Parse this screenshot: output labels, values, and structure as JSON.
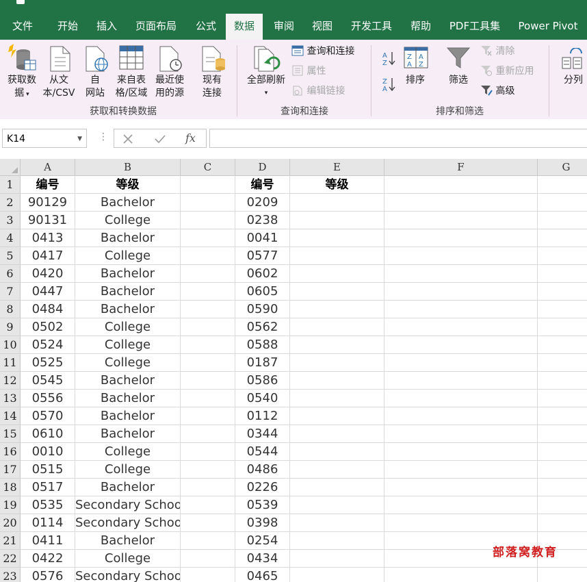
{
  "tabs": [
    "文件",
    "开始",
    "插入",
    "页面布局",
    "公式",
    "数据",
    "审阅",
    "视图",
    "开发工具",
    "帮助",
    "PDF工具集",
    "Power Pivot"
  ],
  "active_tab": "数据",
  "ribbon": {
    "get_data_1": "获取数",
    "get_data_2": "据",
    "from_text_1": "从文",
    "from_text_2": "本/CSV",
    "from_web_1": "自",
    "from_web_2": "网站",
    "from_table_1": "来自表",
    "from_table_2": "格/区域",
    "recent_1": "最近使",
    "recent_2": "用的源",
    "existing_1": "现有",
    "existing_2": "连接",
    "group1_label": "获取和转换数据",
    "refresh_all": "全部刷新",
    "queries_connections": "查询和连接",
    "properties": "属性",
    "edit_links": "编辑链接",
    "group2_label": "查询和连接",
    "sort": "排序",
    "filter": "筛选",
    "clear": "清除",
    "reapply": "重新应用",
    "advanced": "高级",
    "group3_label": "排序和筛选",
    "text_to_columns": "分列"
  },
  "formula_bar": {
    "name_box": "K14",
    "fx": "fx",
    "formula": ""
  },
  "columns": [
    "A",
    "B",
    "C",
    "D",
    "E",
    "F",
    "G"
  ],
  "rows": [
    {
      "n": "1",
      "a": "编号",
      "b": "等级",
      "d": "编号",
      "e": "等级"
    },
    {
      "n": "2",
      "a": "90129",
      "b": "Bachelor",
      "d": "0209",
      "e": ""
    },
    {
      "n": "3",
      "a": "90131",
      "b": "College",
      "d": "0238",
      "e": ""
    },
    {
      "n": "4",
      "a": "0413",
      "b": "Bachelor",
      "d": "0041",
      "e": ""
    },
    {
      "n": "5",
      "a": "0417",
      "b": "College",
      "d": "0577",
      "e": ""
    },
    {
      "n": "6",
      "a": "0420",
      "b": "Bachelor",
      "d": "0602",
      "e": ""
    },
    {
      "n": "7",
      "a": "0447",
      "b": "Bachelor",
      "d": "0605",
      "e": ""
    },
    {
      "n": "8",
      "a": "0484",
      "b": "Bachelor",
      "d": "0590",
      "e": ""
    },
    {
      "n": "9",
      "a": "0502",
      "b": "College",
      "d": "0562",
      "e": ""
    },
    {
      "n": "10",
      "a": "0524",
      "b": "College",
      "d": "0588",
      "e": ""
    },
    {
      "n": "11",
      "a": "0525",
      "b": "College",
      "d": "0187",
      "e": ""
    },
    {
      "n": "12",
      "a": "0545",
      "b": "Bachelor",
      "d": "0586",
      "e": ""
    },
    {
      "n": "13",
      "a": "0556",
      "b": "Bachelor",
      "d": "0540",
      "e": ""
    },
    {
      "n": "14",
      "a": "0570",
      "b": "Bachelor",
      "d": "0112",
      "e": ""
    },
    {
      "n": "15",
      "a": "0610",
      "b": "Bachelor",
      "d": "0344",
      "e": ""
    },
    {
      "n": "16",
      "a": "0010",
      "b": "College",
      "d": "0544",
      "e": ""
    },
    {
      "n": "17",
      "a": "0515",
      "b": "College",
      "d": "0486",
      "e": ""
    },
    {
      "n": "18",
      "a": "0517",
      "b": "Bachelor",
      "d": "0226",
      "e": ""
    },
    {
      "n": "19",
      "a": "0535",
      "b": "Secondary School",
      "d": "0539",
      "e": ""
    },
    {
      "n": "20",
      "a": "0114",
      "b": "Secondary School",
      "d": "0398",
      "e": ""
    },
    {
      "n": "21",
      "a": "0411",
      "b": "Bachelor",
      "d": "0254",
      "e": ""
    },
    {
      "n": "22",
      "a": "0422",
      "b": "College",
      "d": "0434",
      "e": ""
    },
    {
      "n": "23",
      "a": "0576",
      "b": "Secondary School",
      "d": "0465",
      "e": ""
    }
  ],
  "watermark": "部落窝教育",
  "colors": {
    "brand_green": "#217346",
    "ribbon_bg": "#f6edf6",
    "watermark_red": "#d02020"
  }
}
